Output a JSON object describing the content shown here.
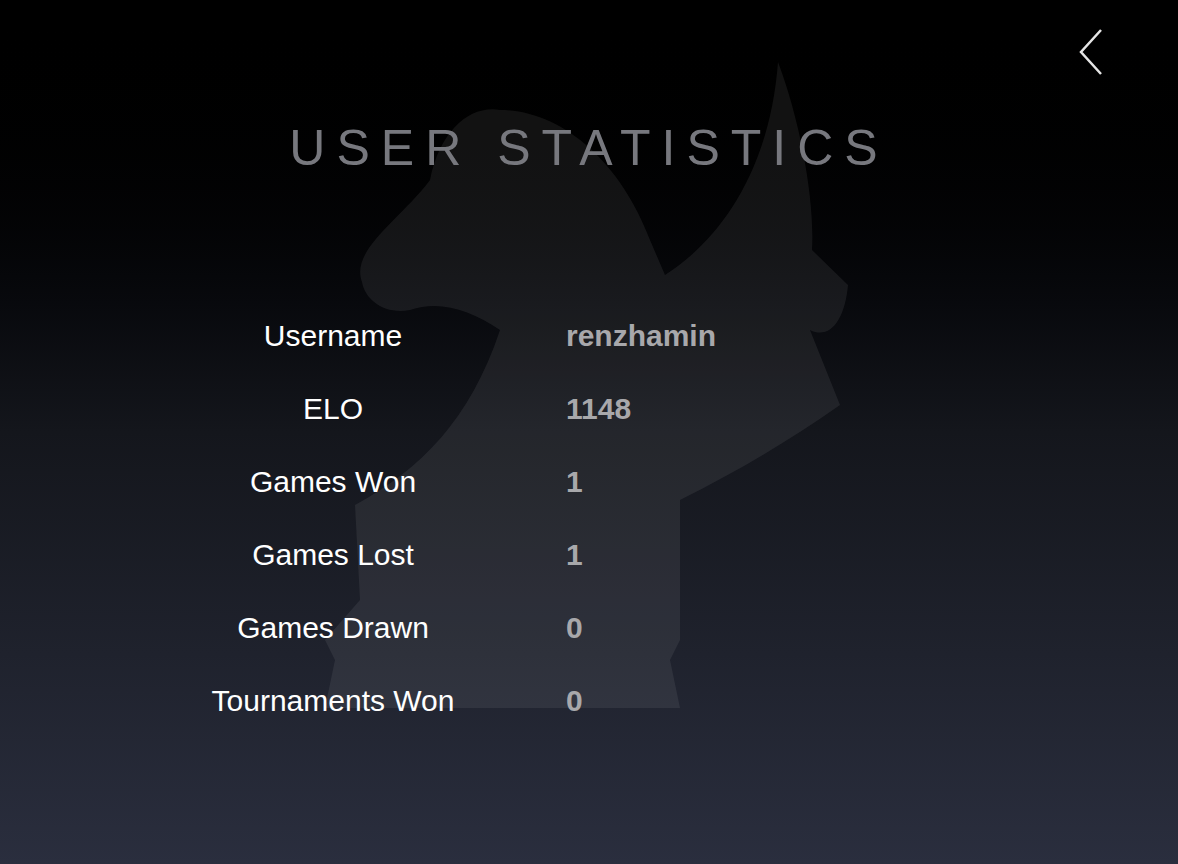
{
  "title": "USER STATISTICS",
  "stats": [
    {
      "label": "Username",
      "value": "renzhamin"
    },
    {
      "label": "ELO",
      "value": "1148"
    },
    {
      "label": "Games Won",
      "value": "1"
    },
    {
      "label": "Games Lost",
      "value": "1"
    },
    {
      "label": "Games Drawn",
      "value": "0"
    },
    {
      "label": "Tournaments Won",
      "value": "0"
    }
  ]
}
